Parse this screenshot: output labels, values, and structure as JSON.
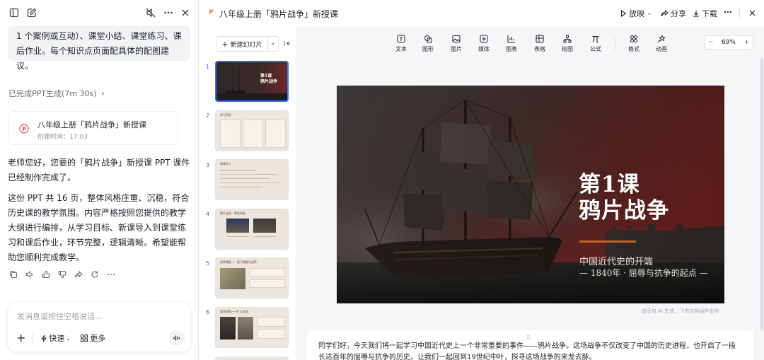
{
  "chat": {
    "prev_message": "1 个案例或互动）、课堂小结、课堂练习、课后作业。每个知识点页面配具体的配图建议。",
    "gen_status": "已完成PPT生成(7m 30s)",
    "file_card": {
      "title": "八年级上册「鸦片战争」新授课",
      "time": "创建时间：17:03"
    },
    "reply_p1": "老师您好，您要的「鸦片战争」新授课 PPT 课件已经制作完成了。",
    "reply_p2": "这份 PPT 共 16 页，整体风格庄重、沉稳，符合历史课的教学氛围。内容严格按照您提供的教学大纲进行编排，从学习目标、新课导入到课堂练习和课后作业，环节完整，逻辑清晰。希望能帮助您顺利完成教学。",
    "input_placeholder": "发消息或按住空格说话...",
    "quick_label": "快速",
    "more_label": "更多"
  },
  "topbar": {
    "doc_badge": "P",
    "title": "八年级上册「鸦片战争」新授课",
    "play": "放映",
    "share": "分享",
    "download": "下载"
  },
  "thumbs": {
    "new_slide": "新建幻灯片",
    "numbers": [
      "1",
      "2",
      "3",
      "4",
      "5",
      "6"
    ],
    "t1_l1": "第1课",
    "t1_l2": "鸦片战争",
    "t2_head": "学习目标",
    "t3_head": "新课导入",
    "t4_head": "鸦片走私：罪恶贸易",
    "t5_head": "战争爆发——虎门销烟与战争",
    "t6_head": "战争进程——扩大战场"
  },
  "toolbar": {
    "tools": [
      "文本",
      "图形",
      "图片",
      "媒体",
      "图表",
      "表格",
      "绘图",
      "公式",
      "格式",
      "动画"
    ],
    "zoom": "69%"
  },
  "slide": {
    "title_l1": "第1课",
    "title_l2": "鸦片战争",
    "subtitle1": "中国近代史的开端",
    "subtitle2": "— 1840年 · 屈辱与抗争的起点 —",
    "credit": "由豆包 AI 生成，飞书文档插件支持"
  },
  "notes": "同学们好，今天我们将一起学习中国近代史上一个非常重要的事件——鸦片战争。这场战争不仅改变了中国的历史进程，也开启了一段长达百年的屈辱与抗争的历史。让我们一起回到19世纪中叶，探寻这场战争的来龙去脉。",
  "colors": {
    "accent": "#3370ff",
    "slide_rule": "#c0622a",
    "badge": "#f0883e"
  }
}
